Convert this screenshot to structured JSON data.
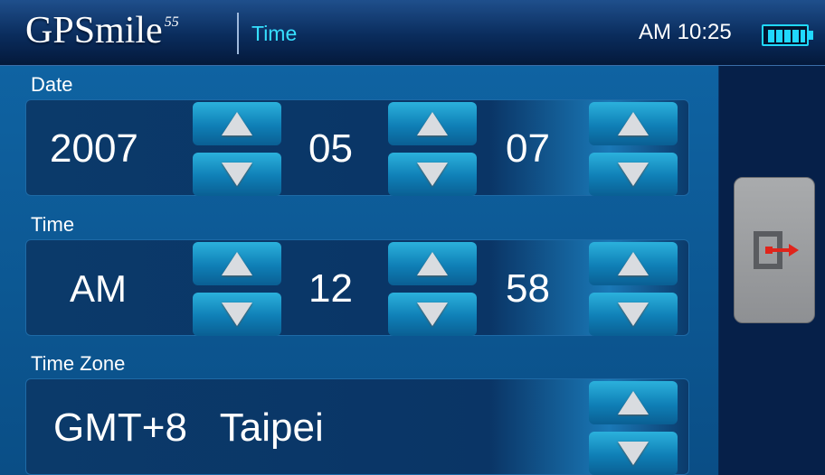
{
  "header": {
    "logo_text": "GPSmile",
    "logo_sup": "55",
    "title": "Time",
    "clock": "AM 10:25",
    "battery_icon": "battery-full-icon"
  },
  "date": {
    "label": "Date",
    "year": "2007",
    "month": "05",
    "day": "07"
  },
  "time": {
    "label": "Time",
    "ampm": "AM",
    "hour": "12",
    "minute": "58"
  },
  "timezone": {
    "label": "Time Zone",
    "value": "GMT+8   Taipei"
  },
  "side": {
    "exit_icon": "exit-icon"
  },
  "colors": {
    "accent": "#36e0ff",
    "battery": "#20d8ff",
    "exit_arrow": "#e0241b"
  }
}
